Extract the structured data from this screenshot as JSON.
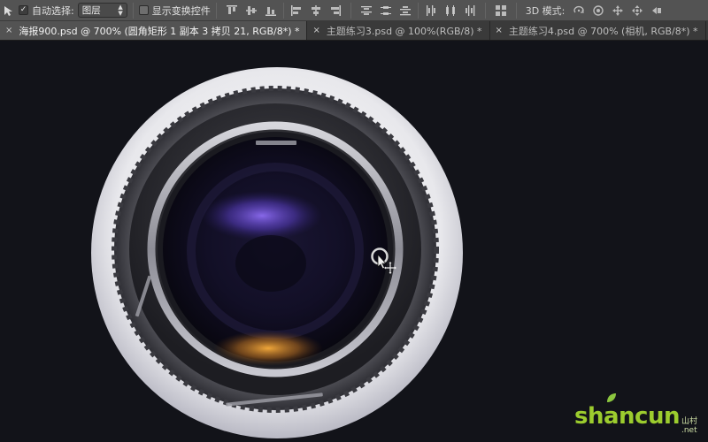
{
  "options_bar": {
    "auto_select_label": "自动选择:",
    "auto_select_checked": true,
    "layer_select_value": "图层",
    "show_transform_label": "显示变换控件",
    "show_transform_checked": false,
    "mode_3d_label": "3D 模式:",
    "align_icons": [
      "align-top-icon",
      "align-vcenter-icon",
      "align-bottom-icon",
      "align-left-icon",
      "align-hcenter-icon",
      "align-right-icon"
    ],
    "distribute_icons": [
      "distribute-top-icon",
      "distribute-vcenter-icon",
      "distribute-bottom-icon",
      "distribute-left-icon",
      "distribute-hcenter-icon",
      "distribute-right-icon"
    ],
    "mode_3d_icons": [
      "rotate-3d-icon",
      "roll-3d-icon",
      "drag-3d-icon",
      "slide-3d-icon",
      "scale-3d-icon"
    ]
  },
  "tabs": [
    {
      "label": "海报900.psd @ 700% (圆角矩形 1 副本 3 拷贝 21, RGB/8*) *",
      "active": true,
      "close": "×"
    },
    {
      "label": "主题练习3.psd @ 100%(RGB/8) *",
      "active": false,
      "close": "×"
    },
    {
      "label": "主题练习4.psd @ 700% (相机, RGB/8*) *",
      "active": false,
      "close": "×"
    }
  ],
  "canvas": {
    "background": "#121319",
    "accent_purple": "#6f4fd6",
    "accent_orange": "#d9912c"
  },
  "watermark": {
    "main": "shancun",
    "sub_top": "山村",
    "sub_bottom": ".net"
  }
}
